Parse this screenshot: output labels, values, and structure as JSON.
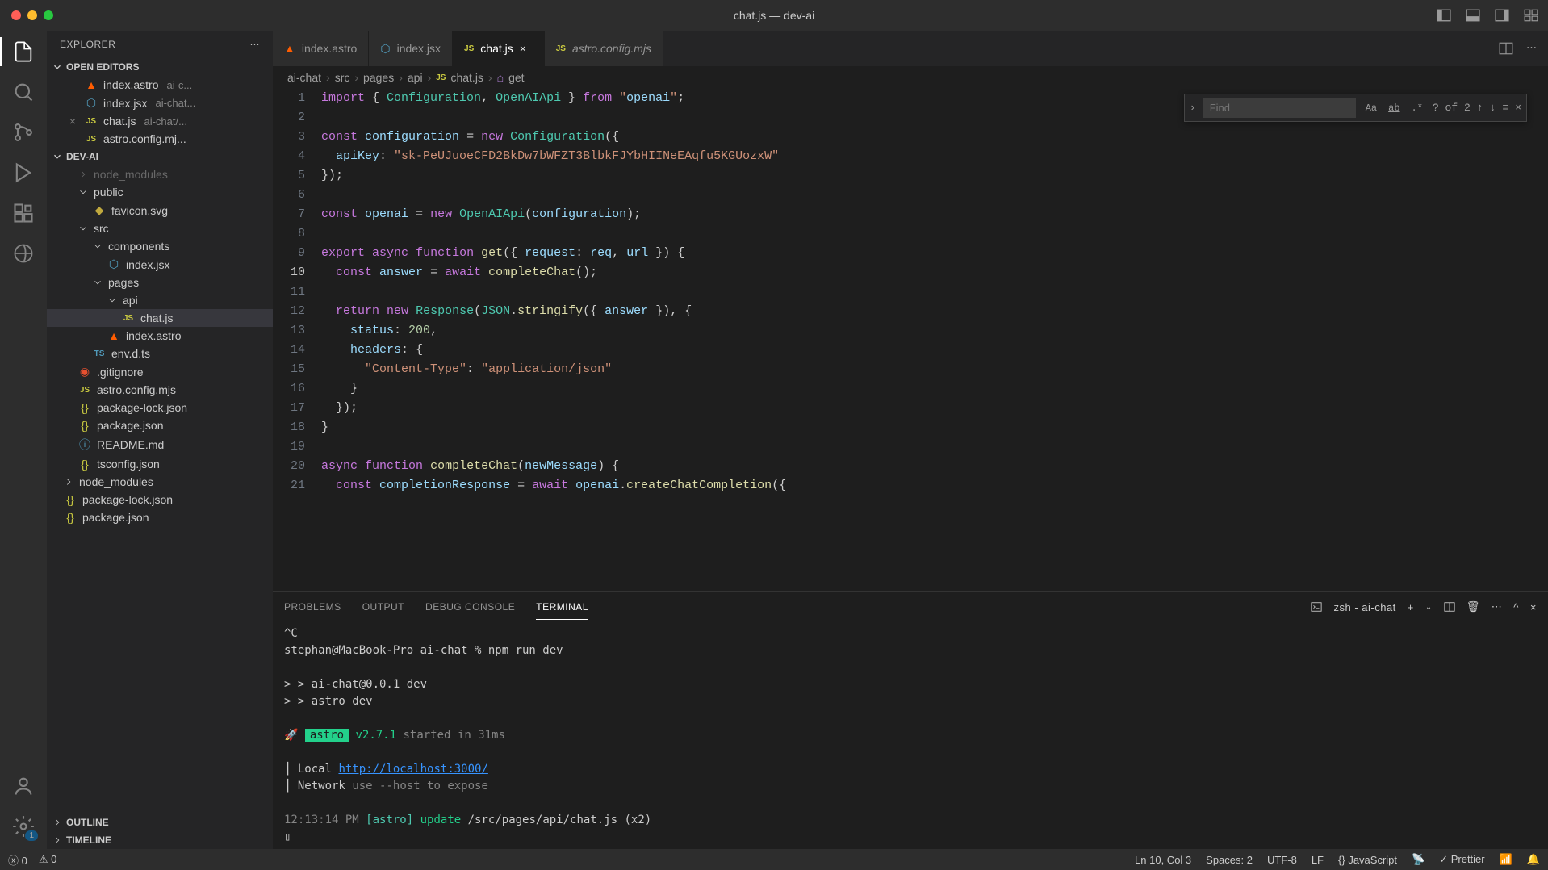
{
  "window": {
    "title": "chat.js — dev-ai"
  },
  "sidebar": {
    "title": "EXPLORER",
    "sections": {
      "openEditors": "OPEN EDITORS",
      "workspace": "DEV-AI",
      "outline": "OUTLINE",
      "timeline": "TIMELINE"
    },
    "openEditors": [
      {
        "name": "index.astro",
        "path": "ai-c..."
      },
      {
        "name": "index.jsx",
        "path": "ai-chat..."
      },
      {
        "name": "chat.js",
        "path": "ai-chat/..."
      },
      {
        "name": "astro.config.mj...",
        "path": ""
      }
    ],
    "tree": {
      "node_modules_cut": "node_modules",
      "public": "public",
      "favicon": "favicon.svg",
      "src": "src",
      "components": "components",
      "indexjsx": "index.jsx",
      "pages": "pages",
      "api": "api",
      "chatjs": "chat.js",
      "indexastro": "index.astro",
      "envdts": "env.d.ts",
      "gitignore": ".gitignore",
      "astroconfig": "astro.config.mjs",
      "pkglock": "package-lock.json",
      "pkg": "package.json",
      "readme": "README.md",
      "tsconfig": "tsconfig.json",
      "nodemodules": "node_modules",
      "pkglock2": "package-lock.json",
      "pkg2": "package.json"
    }
  },
  "tabs": [
    {
      "label": "index.astro",
      "active": false
    },
    {
      "label": "index.jsx",
      "active": false
    },
    {
      "label": "chat.js",
      "active": true
    },
    {
      "label": "astro.config.mjs",
      "active": false
    }
  ],
  "breadcrumbs": [
    "ai-chat",
    "src",
    "pages",
    "api",
    "chat.js",
    "get"
  ],
  "find": {
    "placeholder": "Find",
    "count": "? of 2"
  },
  "code": {
    "lines": [
      {
        "n": 1,
        "t": "import { Configuration, OpenAIApi } from \"openai\";"
      },
      {
        "n": 2,
        "t": ""
      },
      {
        "n": 3,
        "t": "const configuration = new Configuration({"
      },
      {
        "n": 4,
        "t": "  apiKey: \"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\""
      },
      {
        "n": 5,
        "t": "});"
      },
      {
        "n": 6,
        "t": ""
      },
      {
        "n": 7,
        "t": "const openai = new OpenAIApi(configuration);"
      },
      {
        "n": 8,
        "t": ""
      },
      {
        "n": 9,
        "t": "export async function get({ request: req, url }) {"
      },
      {
        "n": 10,
        "t": "  const answer = await completeChat();"
      },
      {
        "n": 11,
        "t": ""
      },
      {
        "n": 12,
        "t": "  return new Response(JSON.stringify({ answer }), {"
      },
      {
        "n": 13,
        "t": "    status: 200,"
      },
      {
        "n": 14,
        "t": "    headers: {"
      },
      {
        "n": 15,
        "t": "      \"Content-Type\": \"application/json\""
      },
      {
        "n": 16,
        "t": "    }"
      },
      {
        "n": 17,
        "t": "  });"
      },
      {
        "n": 18,
        "t": "}"
      },
      {
        "n": 19,
        "t": ""
      },
      {
        "n": 20,
        "t": "async function completeChat(newMessage) {"
      },
      {
        "n": 21,
        "t": "  const completionResponse = await openai.createChatCompletion({"
      }
    ],
    "currentLine": 10
  },
  "panel": {
    "tabs": {
      "problems": "PROBLEMS",
      "output": "OUTPUT",
      "debug": "DEBUG CONSOLE",
      "terminal": "TERMINAL"
    },
    "terminalLabel": "zsh - ai-chat"
  },
  "terminal": {
    "l1": "^C",
    "l2": "stephan@MacBook-Pro ai-chat % npm run dev",
    "l3": "> ai-chat@0.0.1 dev",
    "l4": "> astro dev",
    "rocket": "🚀",
    "astroBadge": "astro",
    "astroVer": "v2.7.1",
    "astroStart": "started in 31ms",
    "localLabel": "Local",
    "localUrl": "http://localhost:3000/",
    "netLabel": "Network",
    "netMsg": "use --host to expose",
    "updateTime": "12:13:14 PM",
    "updateSrc": "[astro]",
    "updateAction": "update",
    "updatePath": "/src/pages/api/chat.js (x2)"
  },
  "status": {
    "errors": "0",
    "warnings": "0",
    "lncol": "Ln 10, Col 3",
    "spaces": "Spaces: 2",
    "encoding": "UTF-8",
    "eol": "LF",
    "lang": "JavaScript",
    "prettier": "Prettier"
  },
  "icons": {
    "js": "JS",
    "ts": "TS",
    "braces": "{}"
  }
}
